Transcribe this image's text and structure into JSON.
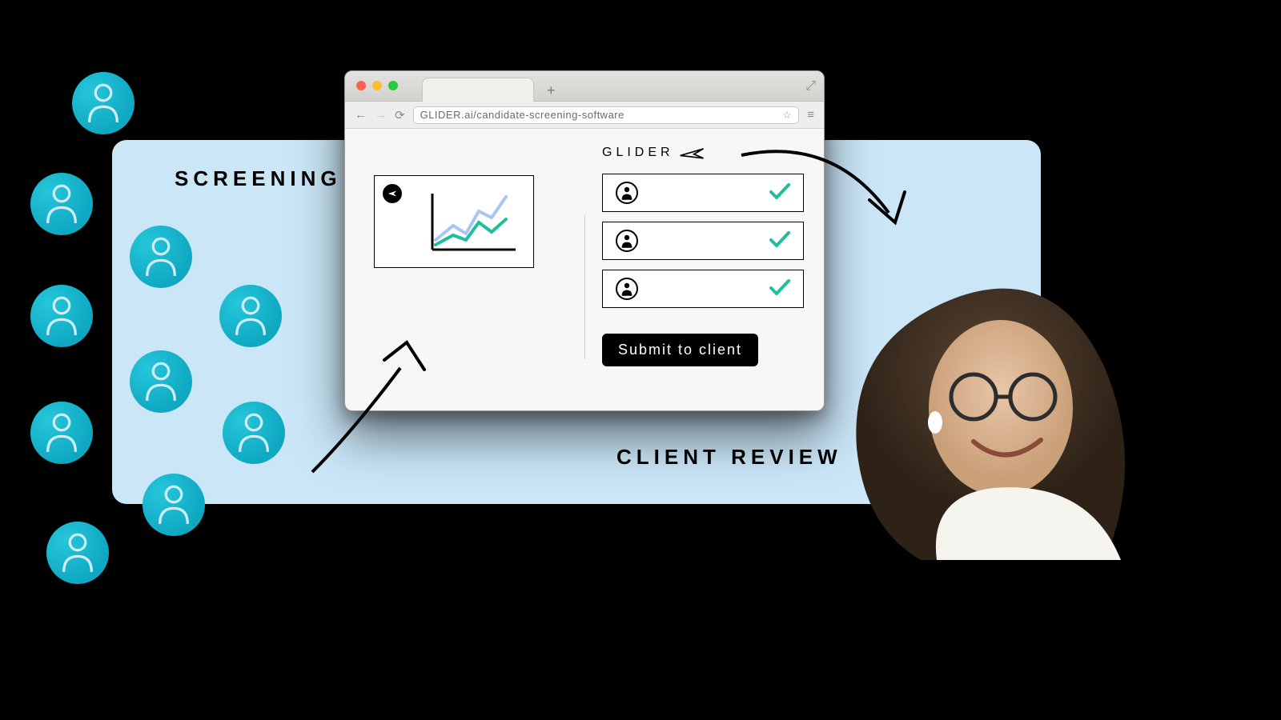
{
  "labels": {
    "screening": "SCREENING",
    "client_review": "CLIENT REVIEW"
  },
  "browser": {
    "url": "GLIDER.ai/candidate-screening-software",
    "brand": "GLIDER",
    "submit_label": "Submit to client"
  },
  "candidates": [
    "ok",
    "ok",
    "ok"
  ]
}
